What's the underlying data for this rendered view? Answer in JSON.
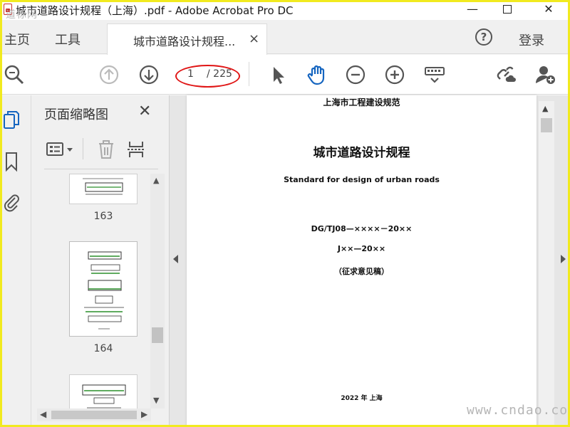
{
  "window": {
    "title": "城市道路设计规程（上海）.pdf - Adobe Acrobat Pro DC",
    "watermark": "道标网",
    "min_glyph": "—",
    "close_glyph": "✕"
  },
  "tabs": {
    "home": "主页",
    "tools": "工具",
    "document": "城市道路设计规程...",
    "close_glyph": "×",
    "help": "?",
    "login": "登录"
  },
  "toolbar": {
    "current_page": "1",
    "total_pages": "/ 225",
    "icons": [
      "search-icon",
      "page-up-icon",
      "page-down-icon",
      "select-cursor-icon",
      "hand-tool-icon",
      "zoom-out-icon",
      "zoom-in-icon",
      "keyboard-tools-icon",
      "share-link-icon",
      "add-user-icon"
    ],
    "accent_color": "#1565c0",
    "highlight_color": "#e01515"
  },
  "sidebar": {
    "title": "页面缩略图",
    "close_glyph": "✕",
    "thumbnails": [
      {
        "page": "163"
      },
      {
        "page": "164"
      },
      {
        "page": ""
      }
    ]
  },
  "document_page": {
    "issuer": "上海市工程建设规范",
    "title_cn": "城市道路设计规程",
    "title_en": "Standard for design of urban roads",
    "code": "DG/TJ08—××××－20××",
    "record": "J××—20××",
    "status": "（征求意见稿）",
    "footer": "2022 年  上海"
  },
  "watermark_site": "www.cndao.com"
}
